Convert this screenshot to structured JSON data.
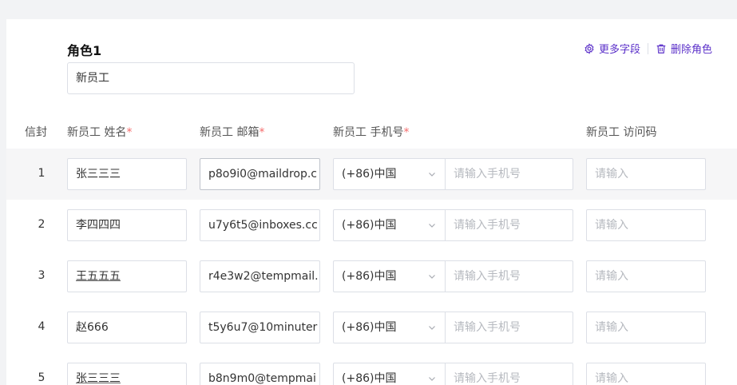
{
  "role": {
    "title": "角色1",
    "name_value": "新员工"
  },
  "actions": {
    "more_fields": "更多字段",
    "delete_role": "删除角色"
  },
  "columns": {
    "index": "信封",
    "name": "新员工 姓名",
    "email": "新员工 邮箱",
    "phone": "新员工 手机号",
    "code": "新员工 访问码",
    "required_mark": "*"
  },
  "rows": [
    {
      "index": "1",
      "name": "张三三三",
      "email": "p8o9i0@maildrop.c",
      "country": "(+86)中国",
      "phone_placeholder": "请输入手机号",
      "code_placeholder": "请输入"
    },
    {
      "index": "2",
      "name": "李四四四",
      "email": "u7y6t5@inboxes.cc",
      "country": "(+86)中国",
      "phone_placeholder": "请输入手机号",
      "code_placeholder": "请输入"
    },
    {
      "index": "3",
      "name": "王五五五",
      "email": "r4e3w2@tempmail.",
      "country": "(+86)中国",
      "phone_placeholder": "请输入手机号",
      "code_placeholder": "请输入"
    },
    {
      "index": "4",
      "name": "赵666",
      "email": "t5y6u7@10minuter",
      "country": "(+86)中国",
      "phone_placeholder": "请输入手机号",
      "code_placeholder": "请输入"
    },
    {
      "index": "5",
      "name": "张三三三",
      "email": "b8n9m0@tempmai",
      "country": "(+86)中国",
      "phone_placeholder": "请输入手机号",
      "code_placeholder": "请输入"
    }
  ],
  "colors": {
    "accent": "#5b30c9",
    "required": "#f56c6c",
    "border": "#dcdfe6",
    "placeholder": "#b6b9bf"
  }
}
